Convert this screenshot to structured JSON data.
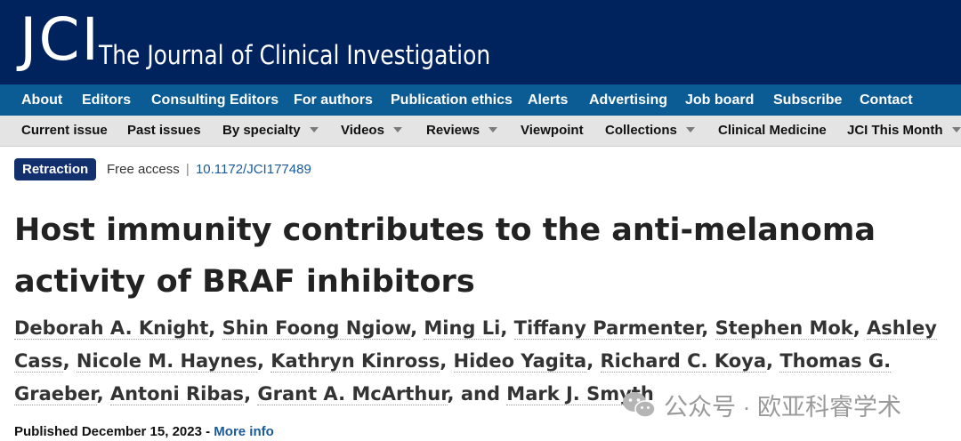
{
  "header": {
    "logo": "JCI",
    "journal_title": "The Journal of Clinical Investigation"
  },
  "primary_nav": [
    "About",
    "Editors",
    "Consulting Editors",
    "For authors",
    "Publication ethics",
    "Alerts",
    "Advertising",
    "Job board",
    "Subscribe",
    "Contact"
  ],
  "secondary_nav": [
    {
      "label": "Current issue",
      "dropdown": false
    },
    {
      "label": "Past issues",
      "dropdown": false
    },
    {
      "label": "By specialty",
      "dropdown": true
    },
    {
      "label": "Videos",
      "dropdown": true
    },
    {
      "label": "Reviews",
      "dropdown": true
    },
    {
      "label": "Viewpoint",
      "dropdown": false
    },
    {
      "label": "Collections",
      "dropdown": true
    },
    {
      "label": "Clinical Medicine",
      "dropdown": false
    },
    {
      "label": "JCI This Month",
      "dropdown": true
    }
  ],
  "article": {
    "badge": "Retraction",
    "access": "Free access",
    "separator": "|",
    "doi": "10.1172/JCI177489",
    "title": "Host immunity contributes to the anti-melanoma activity of BRAF inhibitors",
    "authors": [
      "Deborah A. Knight",
      "Shin Foong Ngiow",
      "Ming Li",
      "Tiffany Parmenter",
      "Stephen Mok",
      "Ashley Cass",
      "Nicole M. Haynes",
      "Kathryn Kinross",
      "Hideo Yagita",
      "Richard C. Koya",
      "Thomas G. Graeber",
      "Antoni Ribas",
      "Grant A. McArthur",
      "Mark J. Smyth"
    ],
    "author_connector": "and",
    "published_label": "Published December 15, 2023",
    "published_sep": "-",
    "more_info": "More info"
  },
  "watermark": {
    "text": "公众号 · 欧亚科睿学术",
    "icon": "wechat-icon"
  },
  "colors": {
    "masthead": "#00235e",
    "primary_nav": "#0b5b95",
    "secondary_nav": "#e4e4e4",
    "badge": "#12306d",
    "link": "#1a5a9a"
  }
}
